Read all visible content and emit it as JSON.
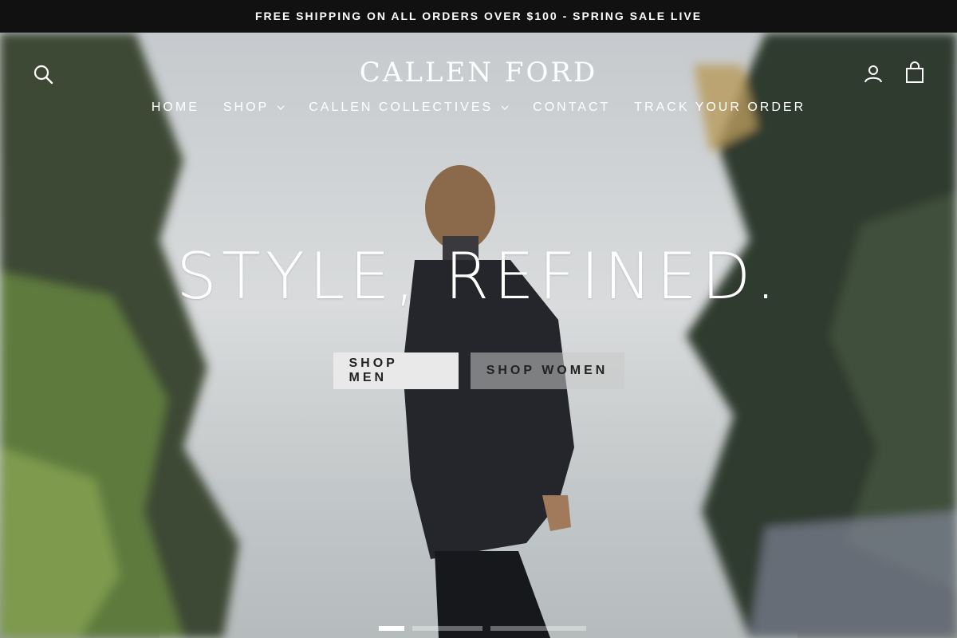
{
  "announcement": {
    "text": "FREE SHIPPING ON ALL ORDERS OVER $100 - SPRING SALE LIVE"
  },
  "header": {
    "logo": "CALLEN FORD",
    "icons": {
      "search": "search-icon",
      "account": "account-icon",
      "cart": "cart-icon"
    }
  },
  "nav": {
    "items": [
      {
        "label": "HOME",
        "has_dropdown": false
      },
      {
        "label": "SHOP",
        "has_dropdown": true
      },
      {
        "label": "CALLEN COLLECTIVES",
        "has_dropdown": true
      },
      {
        "label": "CONTACT",
        "has_dropdown": false
      },
      {
        "label": "TRACK YOUR ORDER",
        "has_dropdown": false
      }
    ]
  },
  "hero": {
    "headline": "STYLE, REFINED.",
    "buttons": {
      "men": "SHOP MEN",
      "women": "SHOP WOMEN"
    },
    "slides": {
      "count": 3,
      "active": 1
    }
  },
  "colors": {
    "announcement_bg": "#111111",
    "text": "#ffffff",
    "button_text": "#222222"
  }
}
